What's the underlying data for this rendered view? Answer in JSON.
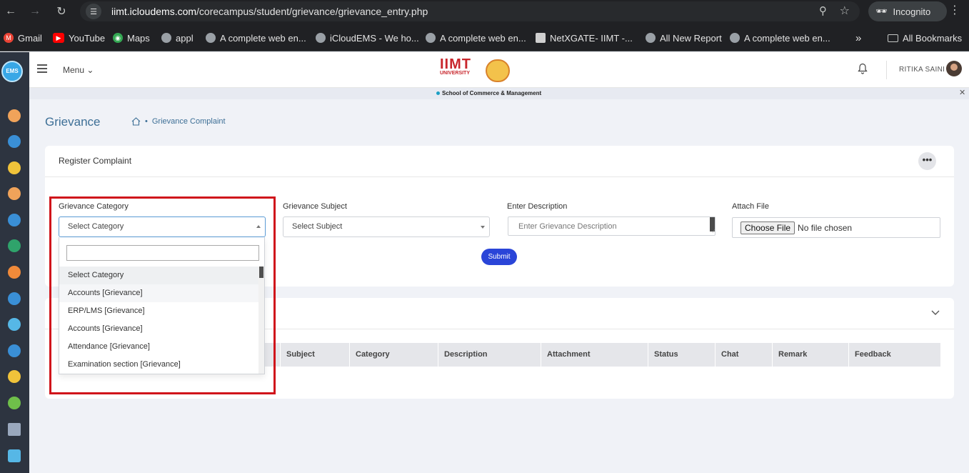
{
  "browser": {
    "url_host": "iimt.icloudems.com",
    "url_path": "/corecampus/student/grievance/grievance_entry.php",
    "incognito_label": "Incognito",
    "bookmarks": [
      {
        "label": "Gmail",
        "icon": "gmail-icon",
        "color": "#ea4335"
      },
      {
        "label": "YouTube",
        "icon": "youtube-icon",
        "color": "#ff0000"
      },
      {
        "label": "Maps",
        "icon": "maps-icon",
        "color": "#34a853"
      },
      {
        "label": "appl",
        "icon": "globe-icon",
        "color": "#9aa0a6"
      },
      {
        "label": "A complete web en...",
        "icon": "globe-icon",
        "color": "#9aa0a6"
      },
      {
        "label": "iCloudEMS - We ho...",
        "icon": "globe-icon",
        "color": "#9aa0a6"
      },
      {
        "label": "A complete web en...",
        "icon": "globe-icon",
        "color": "#9aa0a6"
      },
      {
        "label": "NetXGATE- IIMT -...",
        "icon": "netxgate-icon",
        "color": "#cfcfcf"
      },
      {
        "label": "All New Report",
        "icon": "globe-icon",
        "color": "#9aa0a6"
      },
      {
        "label": "A complete web en...",
        "icon": "globe-icon",
        "color": "#9aa0a6"
      }
    ],
    "more_bookmarks": "»",
    "all_bookmarks": "All Bookmarks"
  },
  "header": {
    "menu_label": "Menu",
    "logo_text": "IIMT",
    "logo_sub": "UNIVERSITY",
    "user_name": "RITIKA SAINI"
  },
  "school_bar": {
    "text": "School of Commerce & Management"
  },
  "page": {
    "title": "Grievance",
    "breadcrumb": "Grievance Complaint"
  },
  "register": {
    "card_title": "Register Complaint",
    "category_label": "Grievance Category",
    "category_value": "Select Category",
    "subject_label": "Grievance Subject",
    "subject_value": "Select Subject",
    "description_label": "Enter Description",
    "description_placeholder": "Enter Grievance Description",
    "file_label": "Attach File",
    "choose_file": "Choose File",
    "no_file": "No file chosen",
    "submit": "Submit"
  },
  "dropdown": {
    "search_value": "",
    "options": [
      "Select Category",
      "Accounts [Grievance]",
      "ERP/LMS [Grievance]",
      "Accounts [Grievance]",
      "Attendance [Grievance]",
      "Examination section [Grievance]"
    ]
  },
  "table": {
    "columns": [
      "Subject",
      "Category",
      "Description",
      "Attachment",
      "Status",
      "Chat",
      "Remark",
      "Feedback"
    ]
  },
  "colors": {
    "accent": "#2a45d8",
    "title": "#3d6f96",
    "highlight": "#d0141b",
    "rail": "#2d3440"
  }
}
